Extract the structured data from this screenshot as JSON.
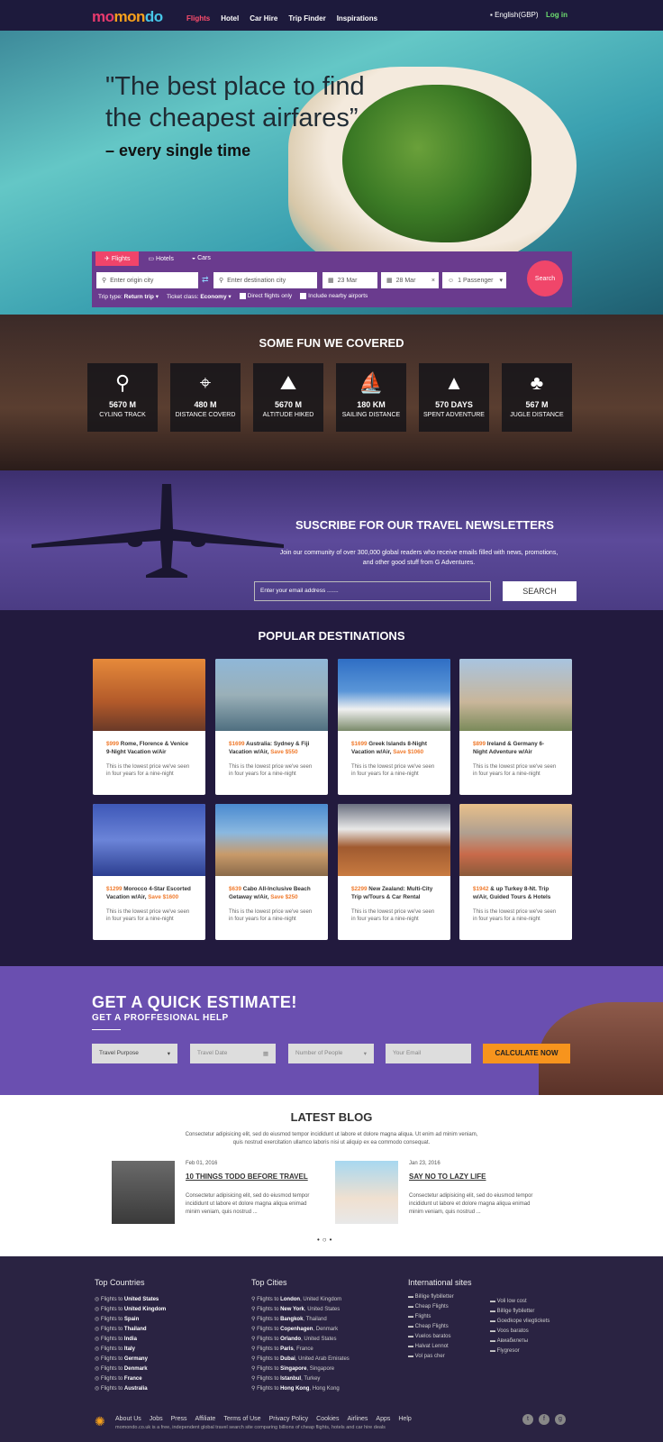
{
  "header": {
    "logo": [
      "mo",
      "mon",
      "do"
    ],
    "nav": [
      "Flights",
      "Hotel",
      "Car Hire",
      "Trip Finder",
      "Inspirations"
    ],
    "language": "English(GBP)",
    "login": "Log in"
  },
  "hero": {
    "quote_line1": "\"The best place to find",
    "quote_line2": "the cheapest airfares”",
    "tagline": "– every single time"
  },
  "search": {
    "tabs": [
      "Flights",
      "Hotels",
      "Cars"
    ],
    "origin_placeholder": "Enter origin city",
    "destination_placeholder": "Enter destination city",
    "depart_date": "23 Mar",
    "return_date": "28 Mar",
    "passengers": "1 Passenger",
    "search_label": "Search",
    "trip_type_label": "Trip type:",
    "trip_type_value": "Return trip",
    "ticket_class_label": "Ticket class:",
    "ticket_class_value": "Economy",
    "direct_flights": "Direct flights only",
    "nearby_airports": "Include nearby airports"
  },
  "fun": {
    "title": "SOME FUN WE COVERED",
    "stats": [
      {
        "value": "5670 M",
        "label": "CYLING TRACK",
        "icon": "bicycle-icon"
      },
      {
        "value": "480 M",
        "label": "DISTANCE COVERD",
        "icon": "route-pin-icon"
      },
      {
        "value": "5670 M",
        "label": "ALTITUDE HIKED",
        "icon": "hiker-icon"
      },
      {
        "value": "180 KM",
        "label": "SAILING DISTANCE",
        "icon": "sailboat-icon"
      },
      {
        "value": "570 DAYS",
        "label": "SPENT ADVENTURE",
        "icon": "mountain-icon"
      },
      {
        "value": "567 M",
        "label": "JUGLE DISTANCE",
        "icon": "jungle-icon"
      }
    ]
  },
  "newsletter": {
    "title": "SUSCRIBE FOR OUR TRAVEL NEWSLETTERS",
    "text": "Join our community of over 300,000 global readers who receive emails filled with news, promotions, and other good stuff from G Adventures.",
    "email_placeholder": "Enter your email address .......",
    "button": "SEARCH"
  },
  "destinations": {
    "title": "POPULAR DESTINATIONS",
    "desc": "This is the lowest price we've seen in four years for a nine-night",
    "cards": [
      {
        "price": "$999",
        "title": "Rome, Florence & Venice 9-Night Vacation w/Air",
        "save": ""
      },
      {
        "price": "$1699",
        "title": "Australia: Sydney & Fiji Vacation w/Air,",
        "save": "Save $550"
      },
      {
        "price": "$1699",
        "title": "Greek Islands 8-Night Vacation w/Air,",
        "save": "Save $1060"
      },
      {
        "price": "$899",
        "title": "Ireland & Germany 6-Night Adventure w/Air",
        "save": ""
      },
      {
        "price": "$1299",
        "title": "Morocco 4-Star Escorted Vacation w/Air,",
        "save": "Save $1600"
      },
      {
        "price": "$639",
        "title": "Cabo All-Inclusive Beach Getaway w/Air,",
        "save": "Save $250"
      },
      {
        "price": "$2299",
        "title": "New Zealand: Multi-City Trip w/Tours & Car Rental",
        "save": ""
      },
      {
        "price": "$1942",
        "title": "& up Turkey 8-Nt. Trip w/Air, Guided Tours & Hotels",
        "save": ""
      }
    ]
  },
  "estimate": {
    "title": "GET A QUICK ESTIMATE!",
    "subtitle": "GET A PROFFESIONAL HELP",
    "purpose": "Travel Purpose",
    "date": "Travel Date",
    "people": "Number of People",
    "email": "Your Email",
    "button": "CALCULATE NOW"
  },
  "blog": {
    "title": "LATEST BLOG",
    "intro": "Consectetur adipisicing elit, sed do eiusmod tempor incididunt ut labore et dolore magna aliqua. Ut enim ad minim veniam, quis nostrud exercitation ullamco laboris nisi ut aliquip ex ea commodo consequat.",
    "posts": [
      {
        "date": "Feb 01, 2016",
        "title": "10 THINGS TODO BEFORE TRAVEL",
        "text": "Consectetur adipisicing elit, sed do eiusmod tempor incididunt ut labore et dolore magna aliqua enimad minim veniam, quis nostrud ..."
      },
      {
        "date": "Jan 23, 2016",
        "title": "SAY NO TO LAZY LIFE",
        "text": "Consectetur adipisicing elit, sed do eiusmod tempor incididunt ut labore et dolore magna aliqua enimad minim veniam, quis nostrud ..."
      }
    ]
  },
  "footer": {
    "countries_title": "Top Countries",
    "cities_title": "Top Cities",
    "sites_title": "International sites",
    "prefix": "Flights to",
    "countries": [
      "United States",
      "United Kingdom",
      "Spain",
      "Thailand",
      "India",
      "Italy",
      "Germany",
      "Denmark",
      "France",
      "Australia"
    ],
    "cities": [
      [
        "London",
        ", United Kingdom"
      ],
      [
        "New York",
        ", United States"
      ],
      [
        "Bangkok",
        ", Thailand"
      ],
      [
        "Copenhagen",
        ", Denmark"
      ],
      [
        "Orlando",
        ", United States"
      ],
      [
        "Paris",
        ", France"
      ],
      [
        "Dubai",
        ", United Arab Emirates"
      ],
      [
        "Singapore",
        ", Singapore"
      ],
      [
        "Istanbul",
        ", Turkey"
      ],
      [
        "Hong Kong",
        ", Hong Kong"
      ]
    ],
    "sites_col1": [
      "Billige flybilletter",
      "Cheap Flights",
      "Flights",
      "Cheap Flights",
      "Vuelos baratos",
      "Halvat Lennot",
      "Vol pas cher"
    ],
    "sites_col2": [
      "Voli low cost",
      "Billige flybiletter",
      "Goedkope vliegtickets",
      "Voos baratos",
      "Авиабилеты",
      "Flygresor"
    ],
    "links": [
      "About Us",
      "Jobs",
      "Press",
      "Affiliate",
      "Terms of Use",
      "Privacy Policy",
      "Cookies",
      "Airlines",
      "Apps",
      "Help"
    ],
    "tagline": "momondo.co.uk is a free, independent global travel search site comparing billions of cheap flights, hotels and car hire deals",
    "social": [
      "twitter-icon",
      "facebook-icon",
      "google-plus-icon"
    ]
  }
}
